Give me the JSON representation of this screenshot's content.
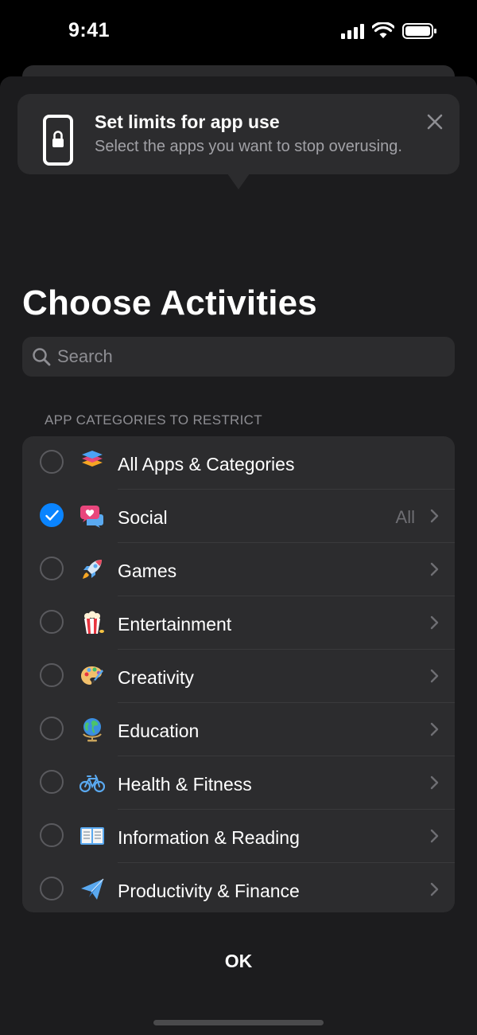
{
  "status_bar": {
    "time": "9:41"
  },
  "tip": {
    "title": "Set limits for app use",
    "subtitle": "Select the apps you want to stop overusing.",
    "icon": "phone-lock-icon"
  },
  "title": "Choose Activities",
  "search": {
    "placeholder": "Search",
    "value": ""
  },
  "section_header": "APP CATEGORIES TO RESTRICT",
  "categories": [
    {
      "label": "All Apps & Categories",
      "checked": false,
      "detail": "",
      "chevron": false,
      "icon": "layers-icon"
    },
    {
      "label": "Social",
      "checked": true,
      "detail": "All",
      "chevron": true,
      "icon": "chat-heart-icon"
    },
    {
      "label": "Games",
      "checked": false,
      "detail": "",
      "chevron": true,
      "icon": "rocket-icon"
    },
    {
      "label": "Entertainment",
      "checked": false,
      "detail": "",
      "chevron": true,
      "icon": "popcorn-icon"
    },
    {
      "label": "Creativity",
      "checked": false,
      "detail": "",
      "chevron": true,
      "icon": "palette-icon"
    },
    {
      "label": "Education",
      "checked": false,
      "detail": "",
      "chevron": true,
      "icon": "globe-icon"
    },
    {
      "label": "Health & Fitness",
      "checked": false,
      "detail": "",
      "chevron": true,
      "icon": "bicycle-icon"
    },
    {
      "label": "Information & Reading",
      "checked": false,
      "detail": "",
      "chevron": true,
      "icon": "book-icon"
    },
    {
      "label": "Productivity & Finance",
      "checked": false,
      "detail": "",
      "chevron": true,
      "icon": "paper-plane-icon"
    }
  ],
  "ok_label": "OK",
  "colors": {
    "accent": "#0a84ff",
    "sheet": "#1c1c1e",
    "cell": "#2c2c2e",
    "secondary_text": "#8e8e93"
  }
}
